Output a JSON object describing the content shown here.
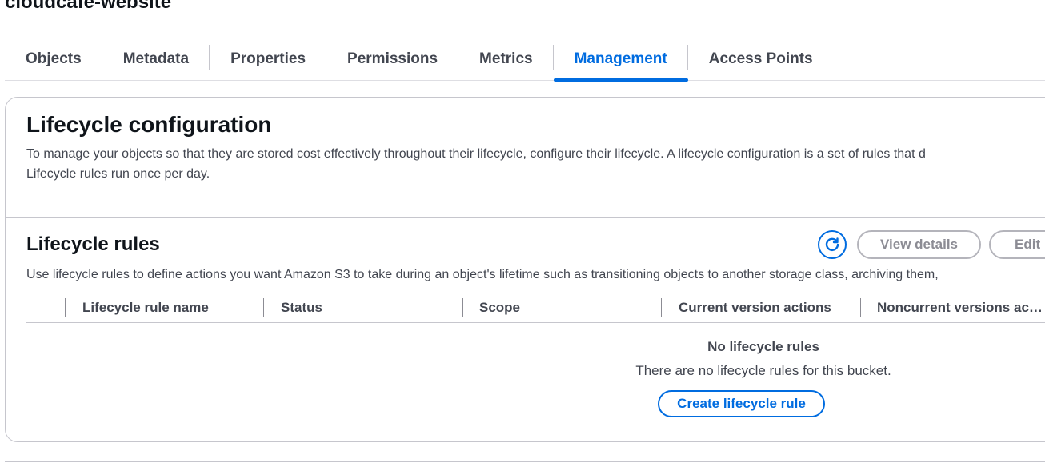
{
  "bucket": {
    "name": "cloudcafe-website"
  },
  "tabs": [
    {
      "label": "Objects",
      "active": false
    },
    {
      "label": "Metadata",
      "active": false
    },
    {
      "label": "Properties",
      "active": false
    },
    {
      "label": "Permissions",
      "active": false
    },
    {
      "label": "Metrics",
      "active": false
    },
    {
      "label": "Management",
      "active": true
    },
    {
      "label": "Access Points",
      "active": false
    }
  ],
  "lifecycle_configuration": {
    "title": "Lifecycle configuration",
    "description_line1": "To manage your objects so that they are stored cost effectively throughout their lifecycle, configure their lifecycle. A lifecycle configuration is a set of rules that d",
    "description_line2": "Lifecycle rules run once per day."
  },
  "lifecycle_rules": {
    "title": "Lifecycle rules",
    "description": "Use lifecycle rules to define actions you want Amazon S3 to take during an object's lifetime such as transitioning objects to another storage class, archiving them,",
    "refresh_icon": "refresh-icon",
    "view_details_label": "View details",
    "edit_label": "Edit",
    "columns": [
      "Lifecycle rule name",
      "Status",
      "Scope",
      "Current version actions",
      "Noncurrent versions ac…"
    ],
    "empty_title": "No lifecycle rules",
    "empty_description": "There are no lifecycle rules for this bucket.",
    "create_button_label": "Create lifecycle rule"
  },
  "colors": {
    "accent": "#006ce0",
    "text_primary": "#0f141a",
    "text_secondary": "#424650",
    "disabled": "#8c8c94",
    "border": "#c6c6cd"
  }
}
